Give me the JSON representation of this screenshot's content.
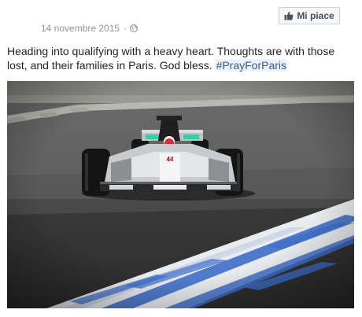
{
  "post": {
    "date": "14 novembre 2015",
    "separator": "·",
    "audience_icon": "globe-icon",
    "text_main": "Heading into qualifying with a heavy heart. Thoughts are with those lost, and their families in Paris. God bless. ",
    "hashtag": "#PrayForParis",
    "photo_icon": "race-car-photo"
  },
  "like_button": {
    "label": "Mi piace",
    "icon": "thumbs-up-icon"
  },
  "colors": {
    "link": "#365899",
    "hashtag_bg": "#edf2fa",
    "meta_text": "#90949c",
    "body_text": "#1d2129",
    "kerb_blue": "#3f6fc9"
  }
}
